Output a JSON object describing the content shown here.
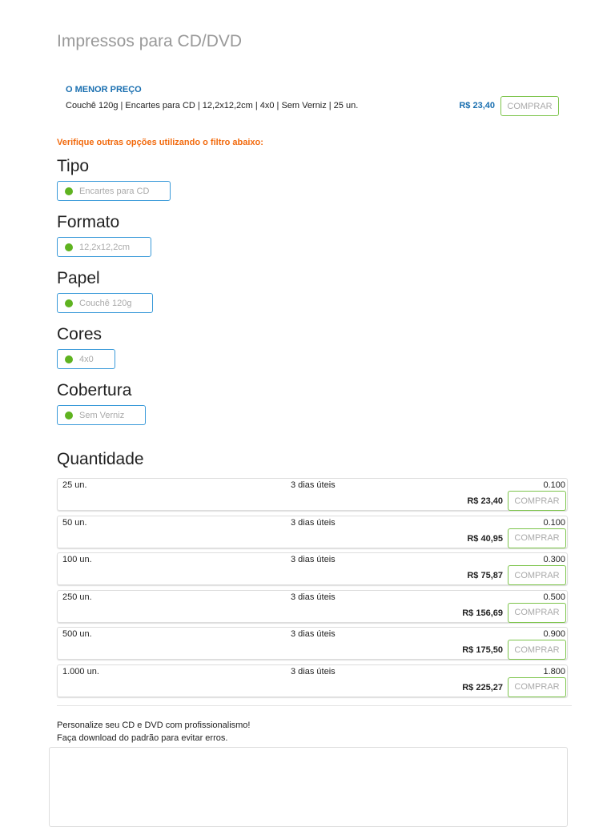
{
  "title": "Impressos para CD/DVD",
  "best": {
    "label": "O MENOR PREÇO",
    "desc": "Couchê 120g | Encartes para CD | 12,2x12,2cm | 4x0 | Sem Verniz | 25 un.",
    "price": "R$ 23,40",
    "buy": "COMPRAR"
  },
  "hint": "Verifique outras opções utilizando o filtro abaixo:",
  "filters": [
    {
      "title": "Tipo",
      "value": "Encartes para CD"
    },
    {
      "title": "Formato",
      "value": "12,2x12,2cm"
    },
    {
      "title": "Papel",
      "value": "Couchê 120g"
    },
    {
      "title": "Cores",
      "value": "4x0"
    },
    {
      "title": "Cobertura",
      "value": "Sem Verniz"
    }
  ],
  "quantity_title": "Quantidade",
  "rows": [
    {
      "qty": "25 un.",
      "days": "3 dias úteis",
      "weight": "0.100",
      "price": "R$ 23,40",
      "buy": "COMPRAR"
    },
    {
      "qty": "50 un.",
      "days": "3 dias úteis",
      "weight": "0.100",
      "price": "R$ 40,95",
      "buy": "COMPRAR"
    },
    {
      "qty": "100 un.",
      "days": "3 dias úteis",
      "weight": "0.300",
      "price": "R$ 75,87",
      "buy": "COMPRAR"
    },
    {
      "qty": "250 un.",
      "days": "3 dias úteis",
      "weight": "0.500",
      "price": "R$ 156,69",
      "buy": "COMPRAR"
    },
    {
      "qty": "500 un.",
      "days": "3 dias úteis",
      "weight": "0.900",
      "price": "R$ 175,50",
      "buy": "COMPRAR"
    },
    {
      "qty": "1.000 un.",
      "days": "3 dias úteis",
      "weight": "1.800",
      "price": "R$ 225,27",
      "buy": "COMPRAR"
    }
  ],
  "note": {
    "line1": "Personalize seu CD e DVD com profissionalismo!",
    "line2": "Faça download do padrão para evitar erros."
  }
}
